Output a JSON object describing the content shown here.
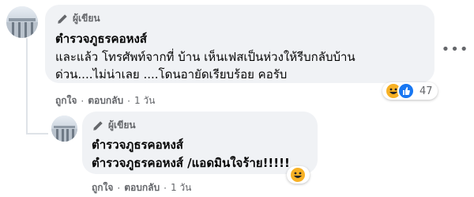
{
  "comment": {
    "author_badge": "ผู้เขียน",
    "name": "ตำรวจภูธรคอหงส์",
    "lines": [
      "และแล้ว โทรศัพท์จากที่ บ้าน เห็นเฟสเป็นห่วงให้รีบกลับบ้าน",
      "ด่วน....ไม่น่าเลย ....โดนอายัดเรียบร้อย คอรับ"
    ],
    "reaction_count": "47",
    "reaction_icons": [
      "haha-icon",
      "like-icon"
    ],
    "actions": {
      "like": "ถูกใจ",
      "reply": "ตอบกลับ",
      "time": "1 วัน"
    },
    "more_icon": "more-horizontal-icon"
  },
  "reply": {
    "author_badge": "ผู้เขียน",
    "name": "ตำรวจภูธรคอหงส์",
    "text": "ตำรวจภูธรคอหงส์ /แอดมินใจร้าย!!!!!",
    "reaction_icons": [
      "haha-icon"
    ],
    "actions": {
      "like": "ถูกใจ",
      "reply": "ตอบกลับ",
      "time": "1 วัน"
    }
  },
  "colors": {
    "bubble": "#f0f2f5",
    "meta": "#65676b",
    "like_blue": "#1877f2",
    "haha_yellow": "#f7b125"
  }
}
